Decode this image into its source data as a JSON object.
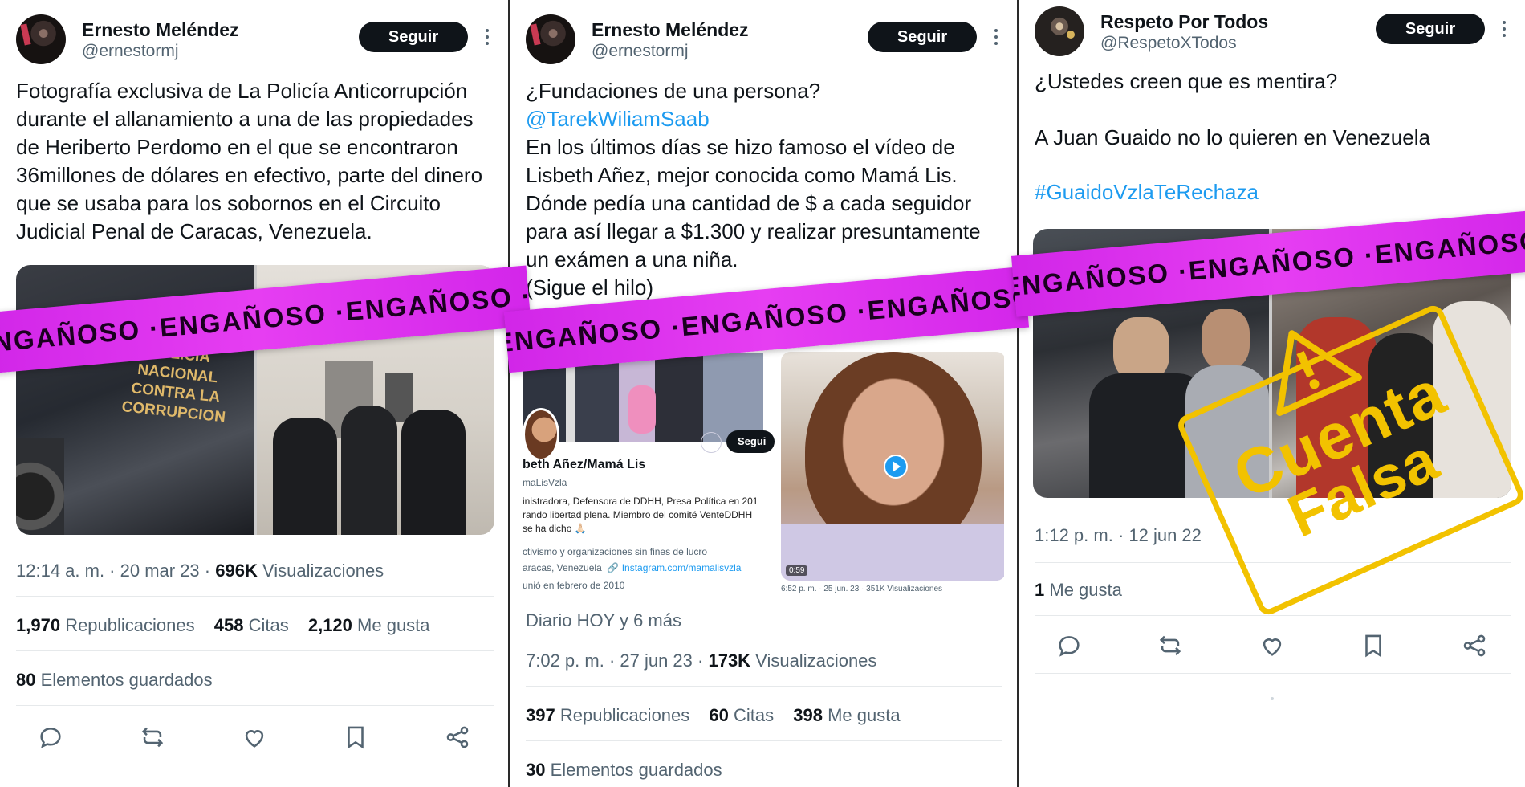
{
  "colors": {
    "banner": "#e63ef2",
    "stamp": "#f2c200",
    "link": "#1d9bf0",
    "button": "#0f1419",
    "muted": "#536471"
  },
  "banner_text": "ENGAÑOSO ·ENGAÑOSO ·ENGAÑOSO ·ENGAÑOSO ·ENGAÑOSO ·ENGAÑOSO ·",
  "stamp": {
    "line1": "Cuenta",
    "line2": "Falsa"
  },
  "tweets": [
    {
      "author": "Ernesto Meléndez",
      "handle": "@ernestormj",
      "follow_label": "Seguir",
      "text": "Fotografía exclusiva de La Policía Anticorrupción durante el allanamiento a una de las propiedades de Heriberto Perdomo en el que se encontraron 36millones de dólares en efectivo, parte del dinero que se usaba para los sobornos en el Circuito Judicial Penal de Caracas, Venezuela.",
      "image_text": "POLICIA NACIONAL CONTRA LA CORRUPCION",
      "meta_time": "12:14 a. m. · 20 mar 23 · ",
      "meta_views": "696K",
      "meta_views_label": " Visualizaciones",
      "reposts": "1,970",
      "reposts_label": "Republicaciones",
      "quotes": "458",
      "quotes_label": "Citas",
      "likes": "2,120",
      "likes_label": "Me gusta",
      "saves": "80",
      "saves_label": "Elementos guardados"
    },
    {
      "author": "Ernesto Meléndez",
      "handle": "@ernestormj",
      "follow_label": "Seguir",
      "text_1": "¿Fundaciones de una persona?",
      "mention": "@TarekWiliamSaab",
      "text_2": "En los últimos días se hizo famoso el vídeo de Lisbeth Añez, mejor conocida como Mamá Lis. Dónde pedía una cantidad de $ a cada seguidor para así llegar a $1.300 y realizar presuntamente un exámen a una niña.\n(Sigue el hilo)",
      "embed": {
        "name": "beth Añez/Mamá Lis",
        "handle": "maLisVzla",
        "follow": "Segui",
        "bio": "inistradora, Defensora de DDHH, Presa Política en 201 rando libertad plena. Miembro del comité VenteDDHH se ha dicho 🙏🏻",
        "line2": "ctivismo y organizaciones sin fines de lucro",
        "location": "aracas, Venezuela",
        "link": "Instagram.com/mamalisvzla",
        "joined": "unió en febrero de 2010",
        "video_time": "0:59",
        "video_meta": "6:52 p. m. · 25 jun. 23 · 351K Visualizaciones"
      },
      "source": "Diario HOY y 6 más",
      "meta_time": "7:02 p. m. · 27 jun 23 · ",
      "meta_views": "173K",
      "meta_views_label": " Visualizaciones",
      "reposts": "397",
      "reposts_label": "Republicaciones",
      "quotes": "60",
      "quotes_label": "Citas",
      "likes": "398",
      "likes_label": "Me gusta",
      "saves": "30",
      "saves_label": "Elementos guardados"
    },
    {
      "author": "Respeto Por Todos",
      "handle": "@RespetoXTodos",
      "follow_label": "Seguir",
      "text_1": "¿Ustedes creen que es mentira?",
      "text_2": "A Juan Guaido no lo quieren en Venezuela",
      "hashtag": "#GuaidoVzlaTeRechaza",
      "meta_time": "1:12 p. m. · 12 jun 22",
      "likes": "1",
      "likes_label": "Me gusta"
    }
  ]
}
